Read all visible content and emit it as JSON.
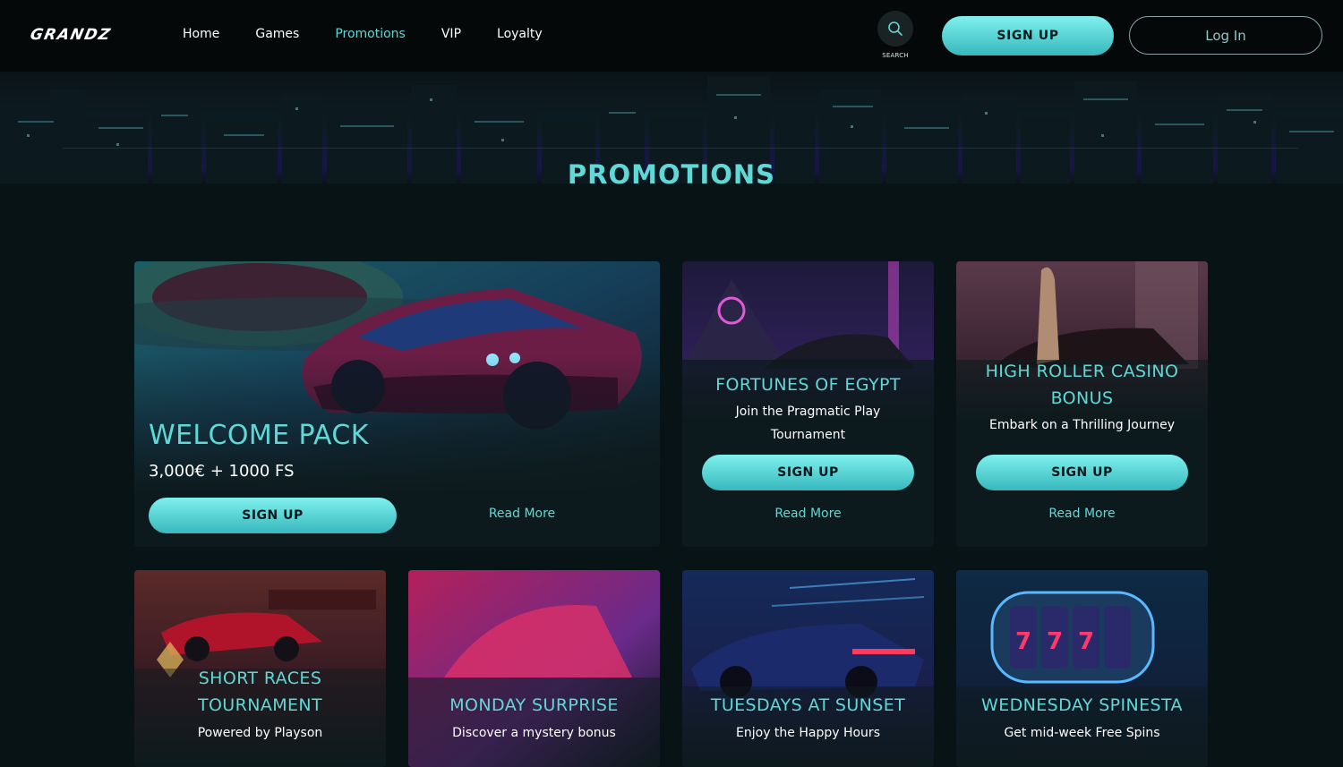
{
  "brand": {
    "logo_text": "GRANDZ"
  },
  "nav": {
    "items": [
      {
        "label": "Home",
        "active": false
      },
      {
        "label": "Games",
        "active": false
      },
      {
        "label": "Promotions",
        "active": true
      },
      {
        "label": "VIP",
        "active": false
      },
      {
        "label": "Loyalty",
        "active": false
      }
    ]
  },
  "search": {
    "label": "SEARCH",
    "icon": "search-icon"
  },
  "auth": {
    "signup_label": "SIGN UP",
    "login_label": "Log In"
  },
  "page": {
    "title": "PROMOTIONS"
  },
  "colors": {
    "accent": "#5fd8d6",
    "background": "#081316",
    "card": "#0d1a1d"
  },
  "promotions": [
    {
      "title": "WELCOME PACK",
      "subtitle": "3,000€ + 1000 FS",
      "button": "SIGN UP",
      "link": "Read More"
    },
    {
      "title": "FORTUNES OF EGYPT",
      "subtitle": "Join the Pragmatic Play Tournament",
      "button": "SIGN UP",
      "link": "Read More"
    },
    {
      "title": "HIGH ROLLER CASINO BONUS",
      "subtitle": "Embark on a Thrilling Journey",
      "button": "SIGN UP",
      "link": "Read More"
    },
    {
      "title": "SHORT RACES TOURNAMENT",
      "subtitle": "Powered by Playson"
    },
    {
      "title": "MONDAY SURPRISE",
      "subtitle": "Discover a mystery bonus"
    },
    {
      "title": "TUESDAYS AT SUNSET",
      "subtitle": "Enjoy the Happy Hours"
    },
    {
      "title": "WEDNESDAY SPINESTA",
      "subtitle": "Get mid-week Free Spins"
    }
  ]
}
